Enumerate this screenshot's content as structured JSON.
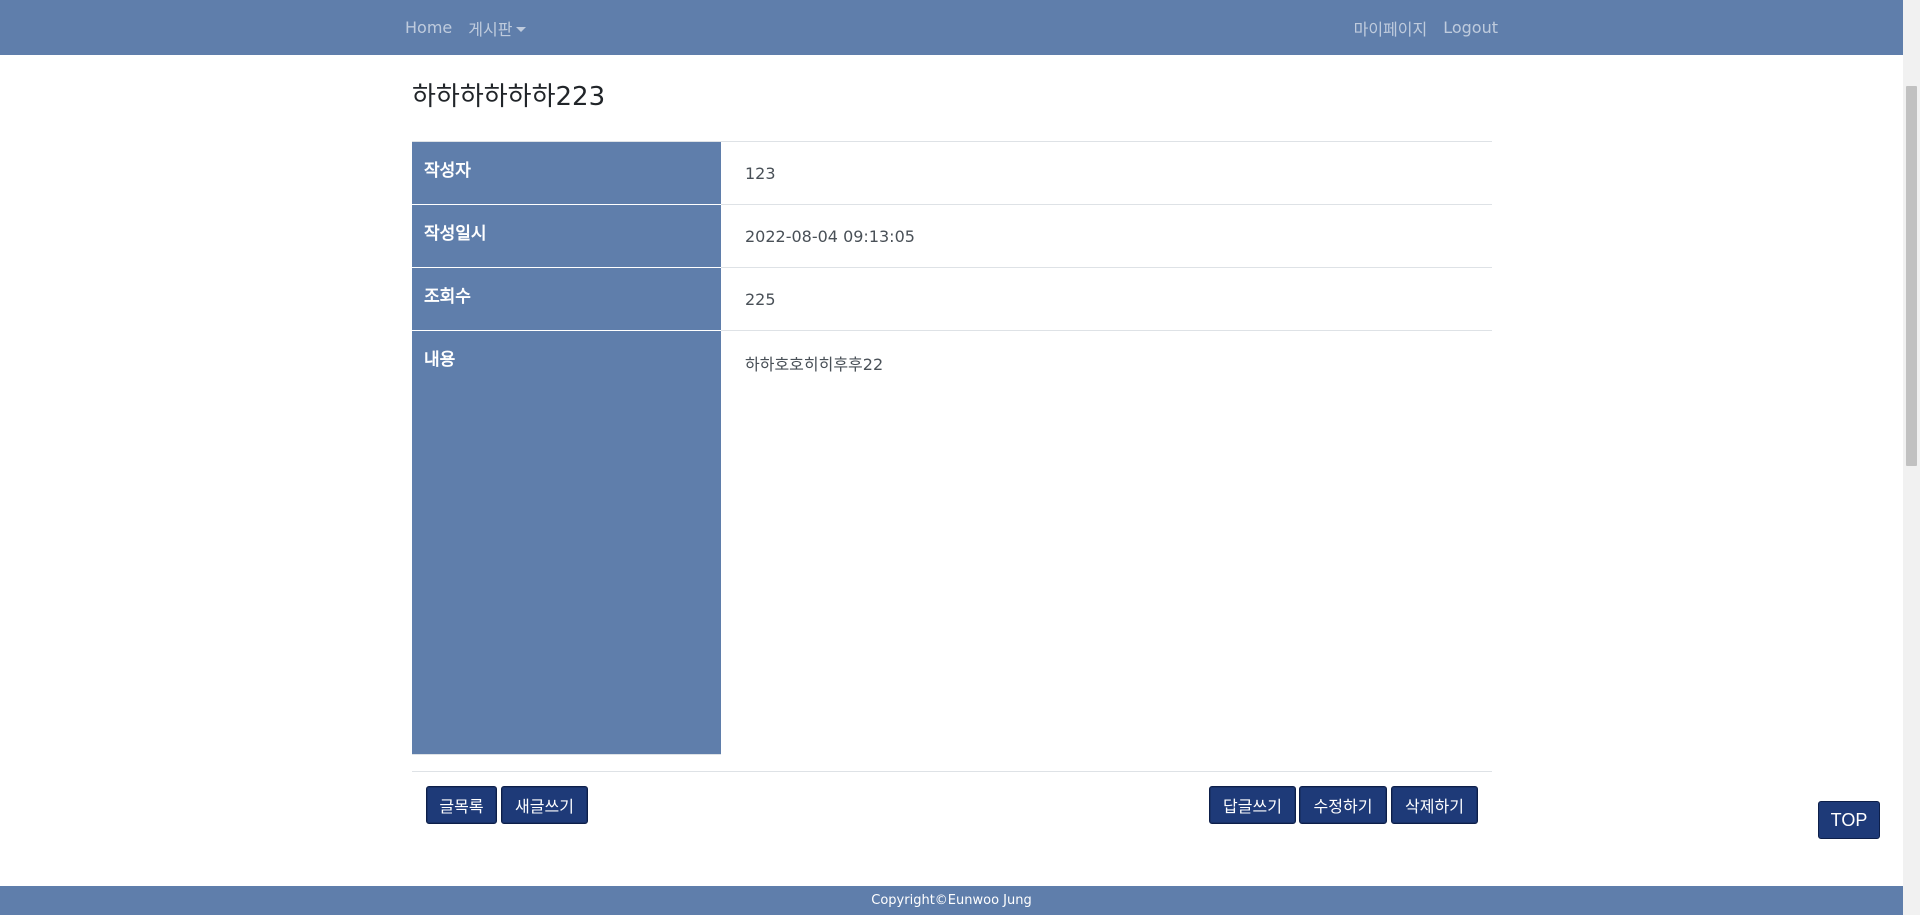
{
  "nav": {
    "home": "Home",
    "board": "게시판",
    "mypage": "마이페이지",
    "logout": "Logout"
  },
  "post": {
    "title": "하하하하하하223",
    "rows": [
      {
        "label": "작성자",
        "value": "123"
      },
      {
        "label": "작성일시",
        "value": "2022-08-04 09:13:05"
      },
      {
        "label": "조회수",
        "value": "225"
      },
      {
        "label": "내용",
        "value": "하하호호히히후후22"
      }
    ]
  },
  "buttons": {
    "list": "글목록",
    "new": "새글쓰기",
    "reply": "답글쓰기",
    "edit": "수정하기",
    "delete": "삭제하기",
    "top": "TOP"
  },
  "footer": {
    "copyright": "Copyright©Eunwoo Jung"
  },
  "colors": {
    "navbar": "#5f7eab",
    "header_cell": "#5f7eab",
    "button": "#1e3a78"
  }
}
